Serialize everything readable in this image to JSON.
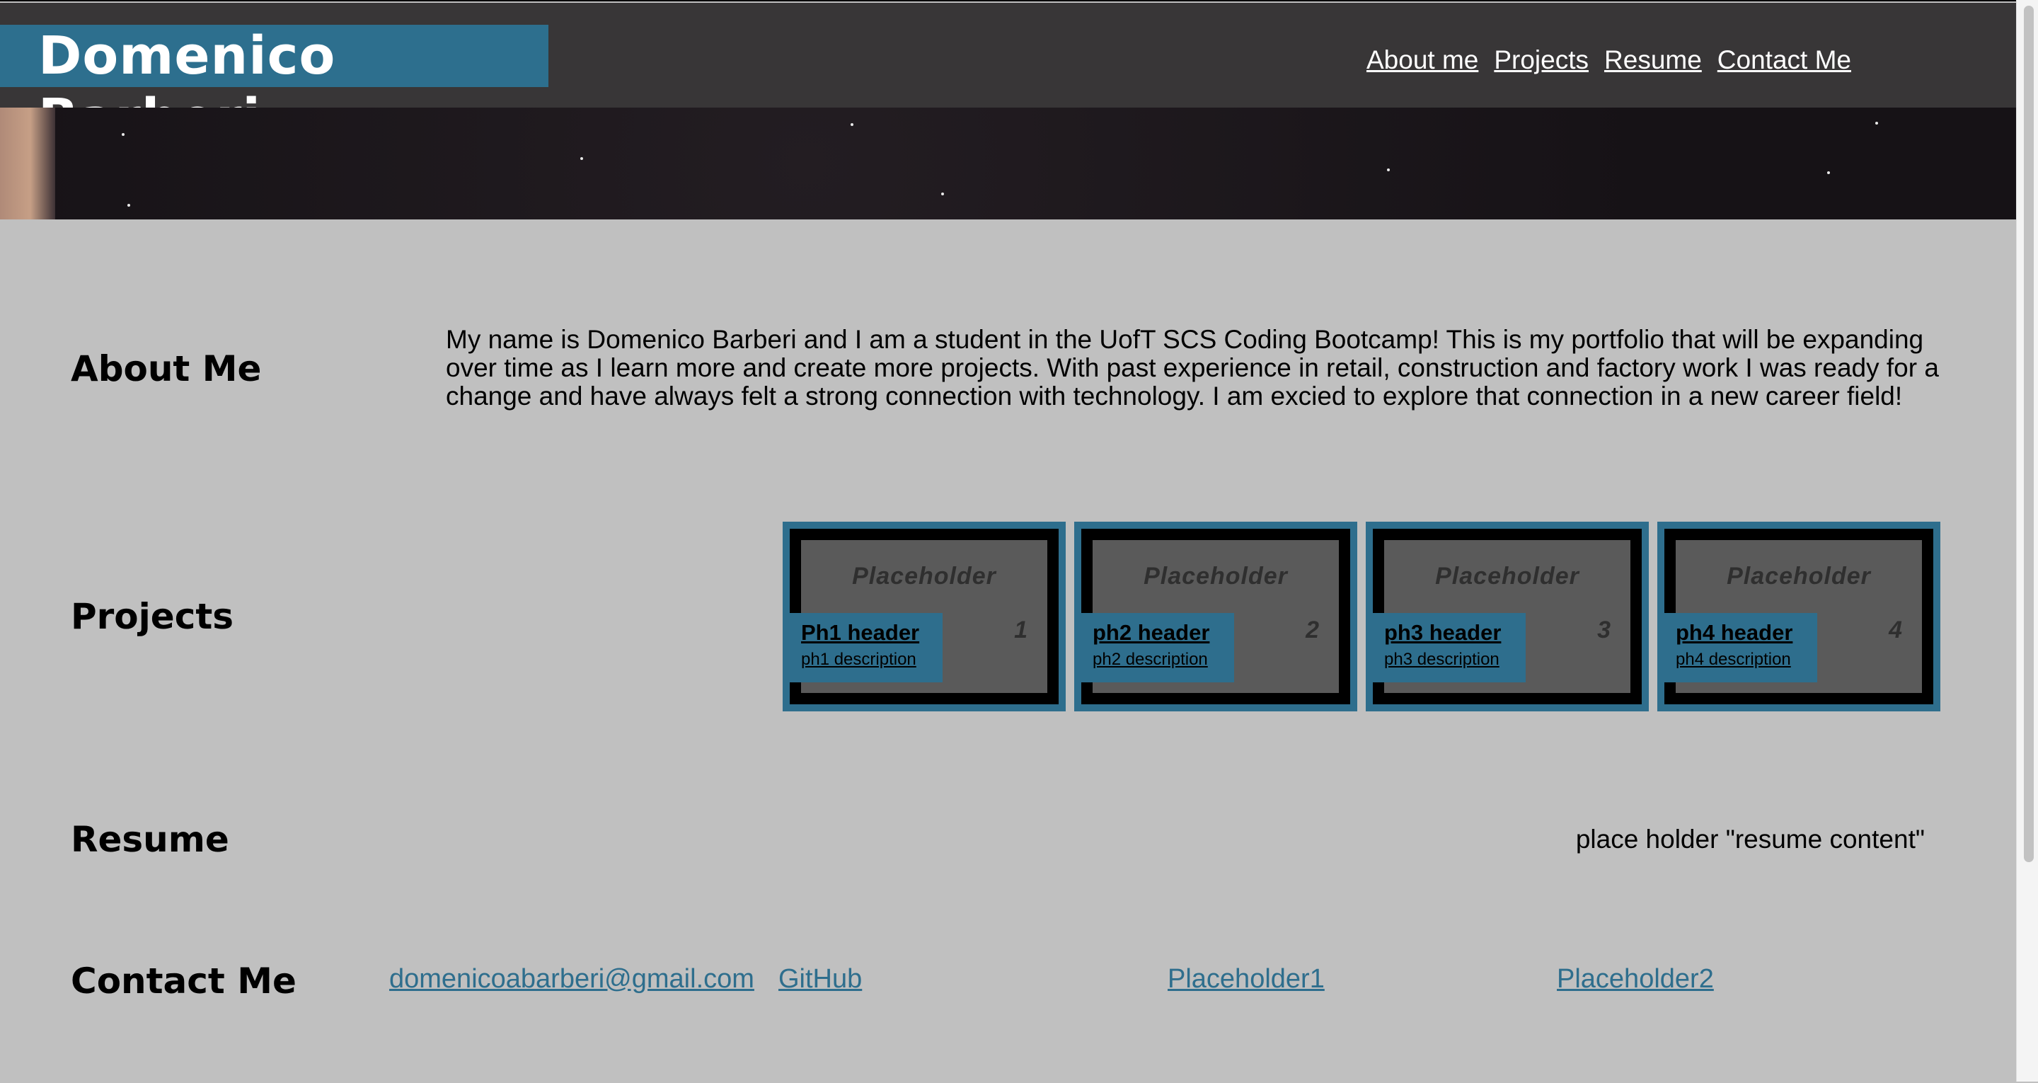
{
  "header": {
    "brand": "Domenico Barberi",
    "nav": [
      "About me",
      "Projects",
      "Resume",
      "Contact Me"
    ]
  },
  "about": {
    "title": "About Me",
    "text": "My name is Domenico Barberi and I am a student in the UofT SCS Coding Bootcamp! This is my portfolio that will be expanding over time as I learn more and create more projects. With past experience in retail, construction and factory work I was ready for a change and have always felt a strong connection with technology. I am excied to explore that connection in a new career field!"
  },
  "projects": {
    "title": "Projects",
    "cards": [
      {
        "image_text": "Placeholder",
        "image_suffix": "1",
        "header": "Ph1 header",
        "description": "ph1 description"
      },
      {
        "image_text": "Placeholder",
        "image_suffix": "2",
        "header": "ph2 header",
        "description": "ph2 description"
      },
      {
        "image_text": "Placeholder",
        "image_suffix": "3",
        "header": "ph3 header",
        "description": "ph3 description"
      },
      {
        "image_text": "Placeholder",
        "image_suffix": "4",
        "header": "ph4 header",
        "description": "ph4 description"
      }
    ]
  },
  "resume": {
    "title": "Resume",
    "text": "place holder \"resume content\""
  },
  "contact": {
    "title": "Contact Me",
    "links": [
      "domenicoabarberi@gmail.com",
      "GitHub",
      "Placeholder1",
      "Placeholder2"
    ]
  },
  "colors": {
    "header_bg": "#383637",
    "accent": "#2e6e8d",
    "page_bg": "#c0c0c0"
  }
}
